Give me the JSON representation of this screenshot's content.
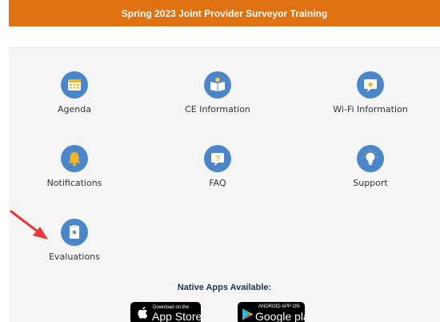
{
  "header": {
    "title": "Spring 2023 Joint Provider Surveyor Training"
  },
  "tiles": [
    {
      "label": "Agenda",
      "icon": "calendar-icon"
    },
    {
      "label": "CE Information",
      "icon": "book-icon"
    },
    {
      "label": "Wi-Fi Information",
      "icon": "wifi-star-icon"
    },
    {
      "label": "Notifications",
      "icon": "bell-icon"
    },
    {
      "label": "FAQ",
      "icon": "question-icon"
    },
    {
      "label": "Support",
      "icon": "lightbulb-icon"
    },
    {
      "label": "Evaluations",
      "icon": "clipboard-star-icon"
    }
  ],
  "apps": {
    "heading": "Native Apps Available:",
    "app_store": {
      "small": "Download on the",
      "big": "App Store"
    },
    "google_play": {
      "small": "ANDROID APP ON",
      "big": "Google play"
    }
  },
  "colors": {
    "header_bg": "#e07111",
    "icon_bg": "#4a86c8",
    "icon_accent": "#f0b429",
    "annotation_arrow": "#e8363a"
  }
}
